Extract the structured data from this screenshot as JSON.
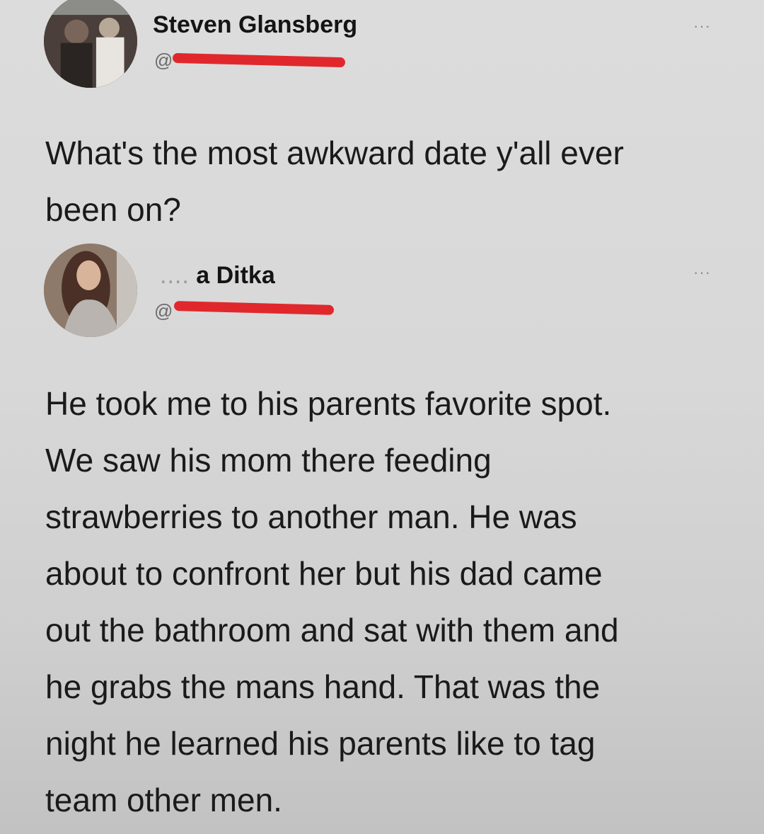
{
  "post": {
    "author_name": "Steven Glansberg",
    "handle_prefix": "@",
    "more_icon": "···",
    "text": "What's the most awkward date y'all ever\nbeen on?"
  },
  "reply": {
    "author_name_visible": "a Ditka",
    "author_name_obscured": "....",
    "handle_prefix": "@",
    "more_icon": "···",
    "text": "He took me to his parents favorite spot.\nWe saw his mom there feeding\nstrawberries to another man. He was\nabout to confront her but his dad came\nout the bathroom and sat with them and\nhe grabs the mans hand. That was the\nnight he learned his parents like to tag\nteam other men."
  },
  "colors": {
    "redaction": "#e0282c",
    "background": "#d8d8d8"
  }
}
